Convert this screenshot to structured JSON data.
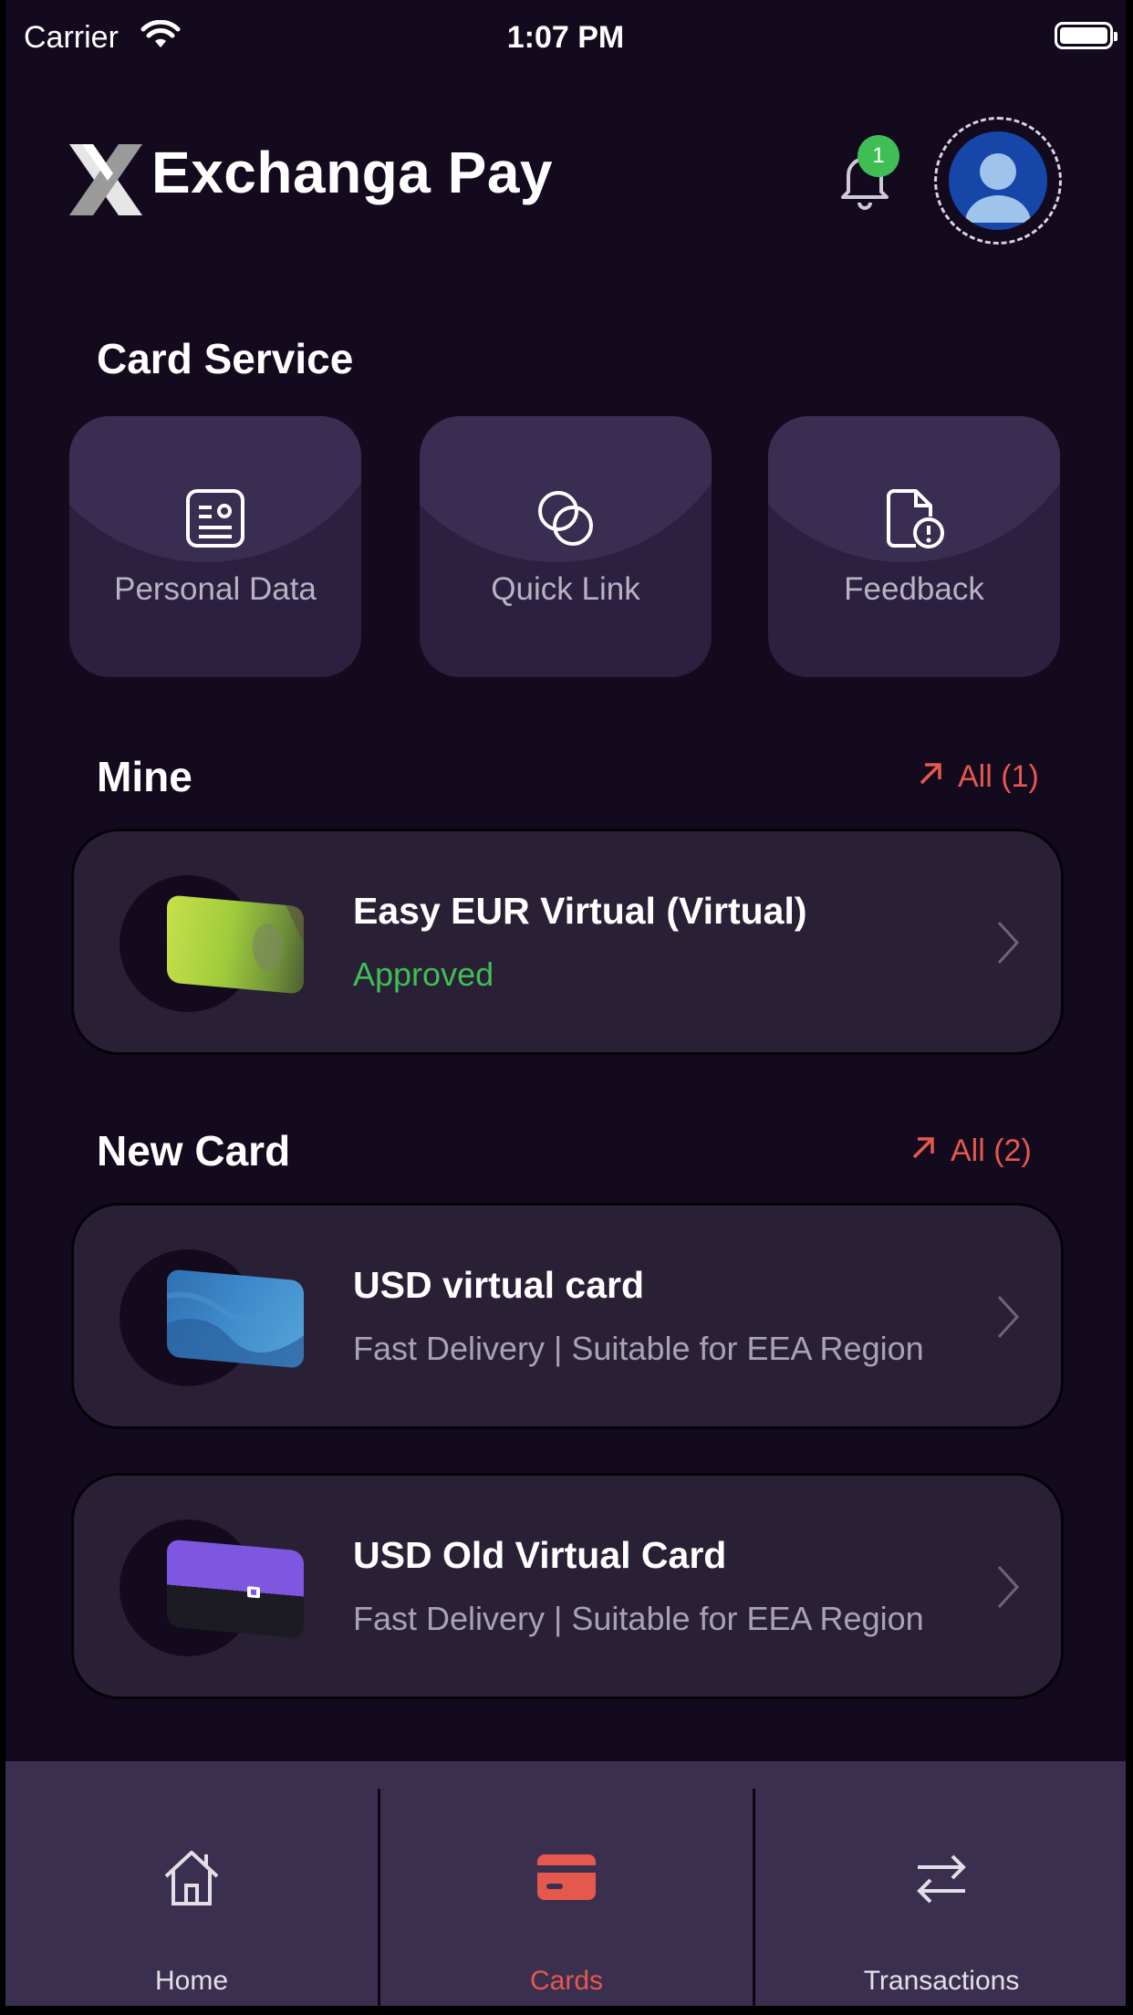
{
  "status_bar": {
    "carrier": "Carrier",
    "time": "1:07 PM"
  },
  "header": {
    "brand": "Exchanga Pay",
    "notification_count": "1"
  },
  "card_service": {
    "title": "Card Service",
    "tiles": [
      {
        "label": "Personal Data",
        "icon": "id-card-icon"
      },
      {
        "label": "Quick Link",
        "icon": "link-circles-icon"
      },
      {
        "label": "Feedback",
        "icon": "document-alert-icon"
      }
    ]
  },
  "mine": {
    "title": "Mine",
    "all_label": "All (1)",
    "cards": [
      {
        "title": "Easy EUR Virtual (Virtual)",
        "subtitle": "Approved"
      }
    ]
  },
  "new_card": {
    "title": "New Card",
    "all_label": "All (2)",
    "cards": [
      {
        "title": "USD virtual card",
        "subtitle": "Fast Delivery | Suitable for EEA Region"
      },
      {
        "title": "USD Old Virtual Card",
        "subtitle": "Fast Delivery | Suitable for EEA Region"
      }
    ]
  },
  "tabs": [
    {
      "label": "Home",
      "icon": "home-icon"
    },
    {
      "label": "Cards",
      "icon": "card-icon",
      "active": true
    },
    {
      "label": "Transactions",
      "icon": "swap-arrows-icon"
    }
  ],
  "colors": {
    "background": "#140a1e",
    "accent": "#e5584d",
    "approved": "#3fbe55",
    "tile": "#2b2040",
    "tabbar": "#3b2f4f"
  }
}
